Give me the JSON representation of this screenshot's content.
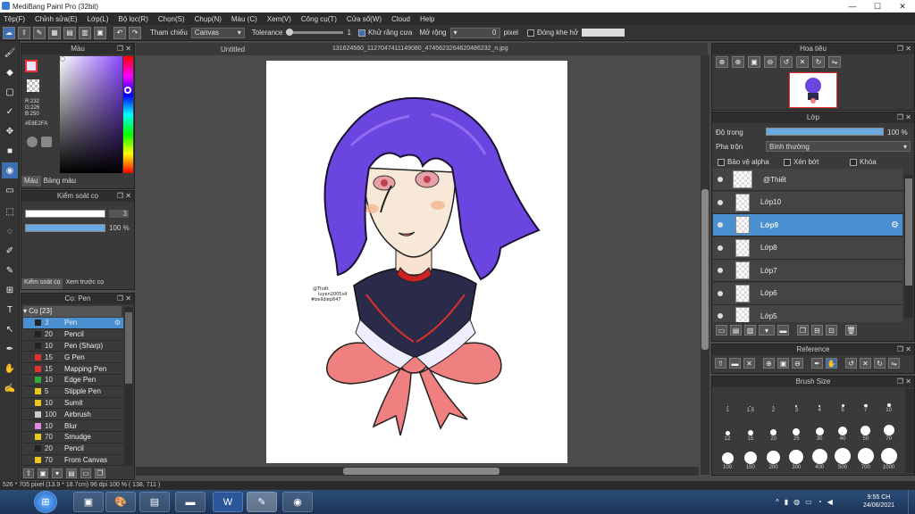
{
  "window": {
    "title": "MediBang Paint Pro (32bit)",
    "minimize": "—",
    "maximize": "☐",
    "close": "✕"
  },
  "menu": [
    "Tệp(F)",
    "Chỉnh sửa(E)",
    "Lớp(L)",
    "Bộ lọc(R)",
    "Chọn(S)",
    "Chụp(N)",
    "Màu (C)",
    "Xem(V)",
    "Công cụ(T)",
    "Cửa sổ(W)",
    "Cloud",
    "Help"
  ],
  "toolbar": {
    "reference_label": "Tham chiếu",
    "reference_value": "Canvas",
    "tolerance_label": "Tolerance",
    "tolerance_value": "1",
    "antialias_label": "Khử răng cưa",
    "expand_label": "Mở rộng",
    "expand_value": "0",
    "pixel_label": "pixel",
    "closegap_label": "Đóng khe hở"
  },
  "color_panel": {
    "title": "Màu",
    "r": "R:232",
    "g": "G:226",
    "b": "B:250",
    "hex": "#E8E2FA",
    "tab_color": "Màu",
    "tab_palette": "Bảng màu",
    "fg_color": "#E8E2FA"
  },
  "brush_control": {
    "title": "Kiểm soát cọ",
    "size": "3",
    "opacity": "100 %",
    "tab_control": "Kiểm soát cọ",
    "tab_preview": "Xem trước cọ"
  },
  "brush_list": {
    "title": "Cọ: Pen",
    "group": "Cọ [23]",
    "items": [
      {
        "size": "3",
        "name": "Pen",
        "color": "#222222"
      },
      {
        "size": "20",
        "name": "Pencil",
        "color": "#222222"
      },
      {
        "size": "10",
        "name": "Pen (Sharp)",
        "color": "#222222"
      },
      {
        "size": "15",
        "name": "G Pen",
        "color": "#e03030"
      },
      {
        "size": "15",
        "name": "Mapping Pen",
        "color": "#e03030"
      },
      {
        "size": "10",
        "name": "Edge Pen",
        "color": "#2fae3a"
      },
      {
        "size": "5",
        "name": "Stipple Pen",
        "color": "#e8c81a"
      },
      {
        "size": "10",
        "name": "Sumit",
        "color": "#e8c81a"
      },
      {
        "size": "100",
        "name": "Airbrush",
        "color": "#cccccc"
      },
      {
        "size": "10",
        "name": "Blur",
        "color": "#e088e0"
      },
      {
        "size": "70",
        "name": "Smudge",
        "color": "#e8c81a"
      },
      {
        "size": "20",
        "name": "Pencil",
        "color": "#222222"
      },
      {
        "size": "70",
        "name": "From Canvas",
        "color": "#e8c81a"
      }
    ]
  },
  "document": {
    "tab_untitled": "Untitled",
    "tab_file": "131624560_1127047411149080_4745623264620486232_n.jpg",
    "watermark": "@Thiết luyen2005s4 #belldiep847"
  },
  "navigator": {
    "title": "Hoa tiêu"
  },
  "layers": {
    "title": "Lớp",
    "opacity_label": "Độ trong",
    "opacity_value": "100 %",
    "blend_label": "Pha trộn",
    "blend_value": "Bình thường",
    "protect_alpha": "Bảo vệ alpha",
    "clipping": "Xén bớt",
    "lock": "Khóa",
    "items": [
      {
        "name": "@Thiết"
      },
      {
        "name": "Lớp10"
      },
      {
        "name": "Lớp9"
      },
      {
        "name": "Lớp8"
      },
      {
        "name": "Lớp7"
      },
      {
        "name": "Lớp6"
      },
      {
        "name": "Lớp5"
      }
    ],
    "selected_index": 2
  },
  "reference": {
    "title": "Reference"
  },
  "brush_size": {
    "title": "Brush Size",
    "values": [
      "1",
      "1.5",
      "2",
      "3",
      "4",
      "5",
      "7",
      "10",
      "12",
      "15",
      "20",
      "25",
      "30",
      "40",
      "50",
      "70",
      "100",
      "150",
      "200",
      "300",
      "400",
      "500",
      "700",
      "1000"
    ]
  },
  "status": {
    "text": "526 * 705 pixel  (13.9 * 18.7cm)  96 dpi  100 %  ( 138, 711 )"
  },
  "taskbar": {
    "time": "9:55 CH",
    "date": "24/06/2021",
    "lang": "^"
  }
}
